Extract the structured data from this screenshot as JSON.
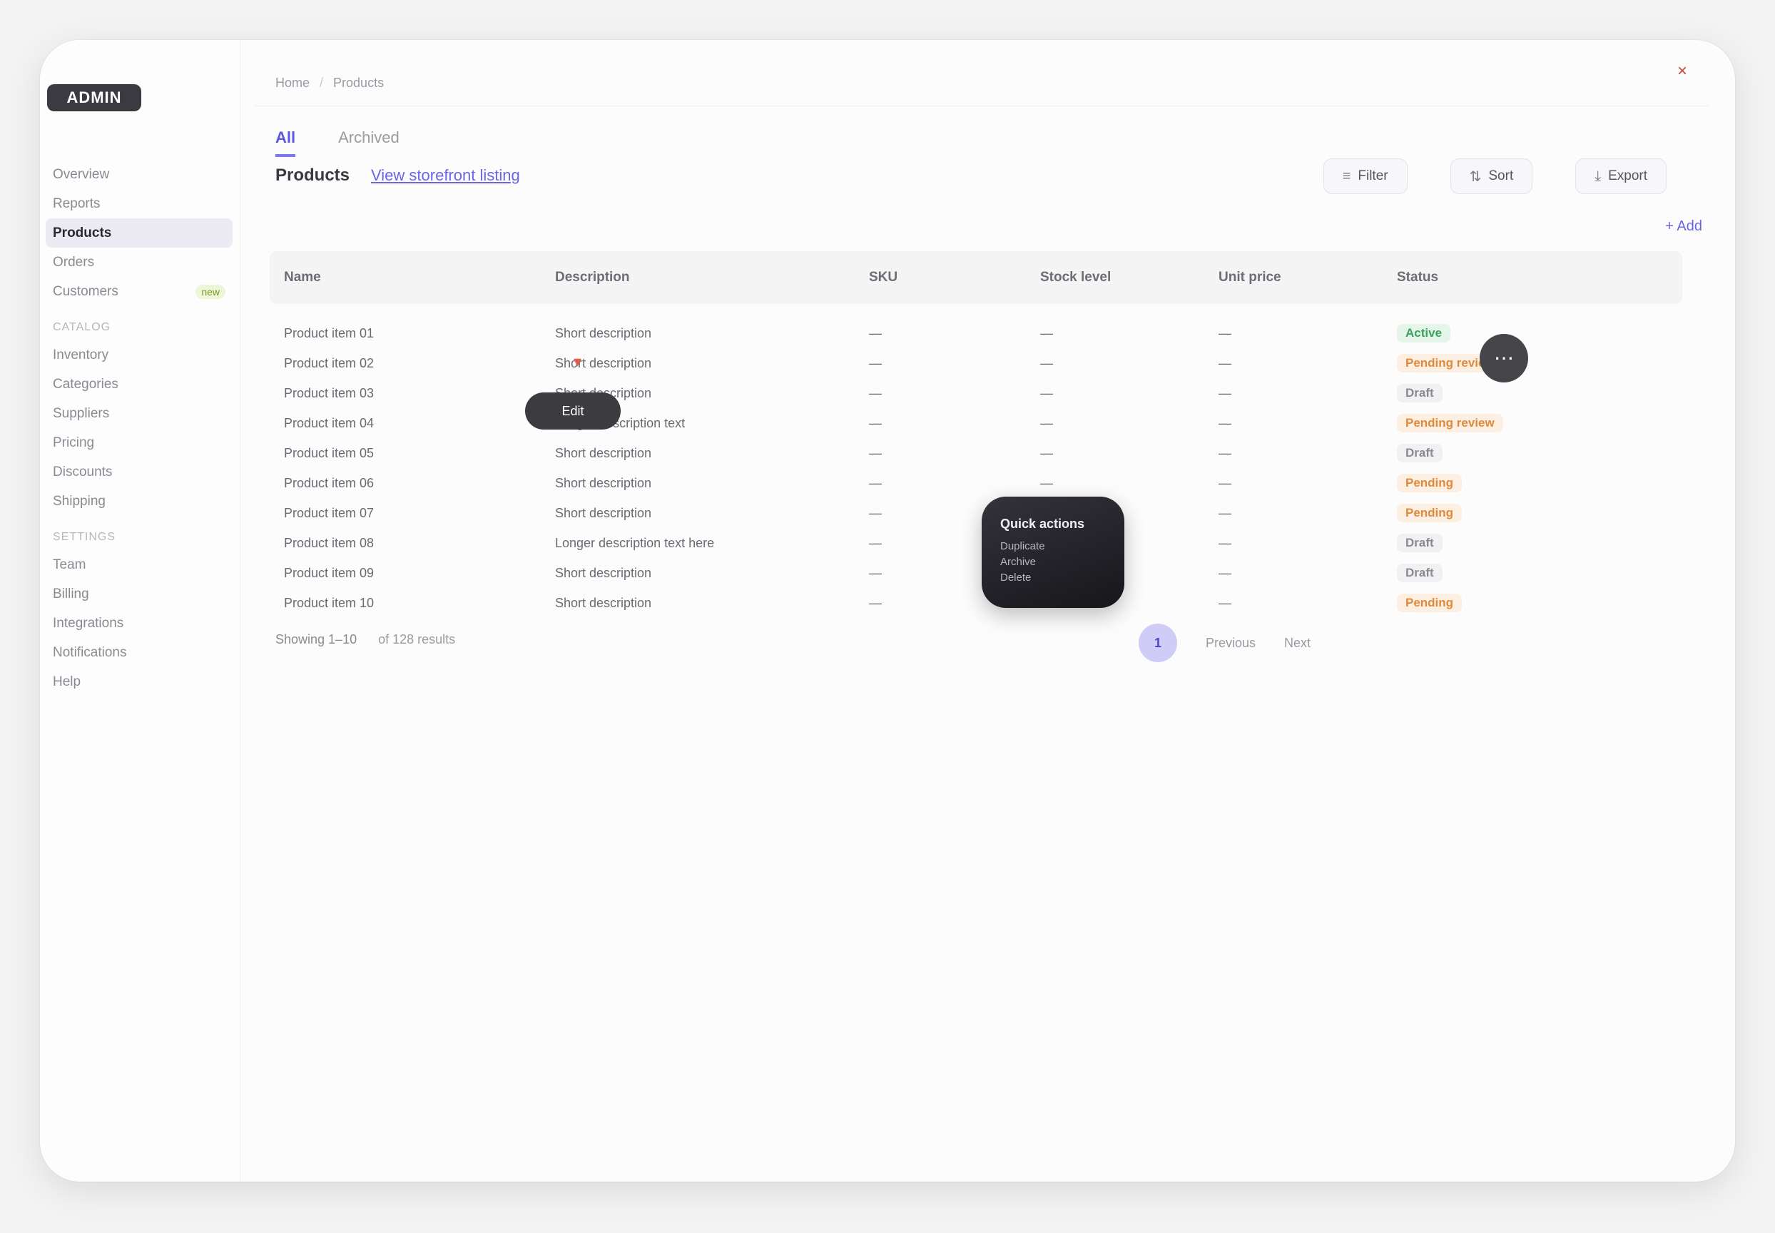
{
  "app": {
    "logo_text": "ADMIN"
  },
  "sidebar": {
    "items": [
      {
        "label": "Overview",
        "active": false
      },
      {
        "label": "Reports",
        "active": false
      },
      {
        "label": "Products",
        "active": true
      },
      {
        "label": "Orders",
        "active": false
      },
      {
        "label": "Customers",
        "active": false,
        "badge": "new"
      },
      {
        "label": "Catalog",
        "section": true
      },
      {
        "label": "Inventory",
        "active": false
      },
      {
        "label": "Categories",
        "active": false
      },
      {
        "label": "Suppliers",
        "active": false
      },
      {
        "label": "Pricing",
        "active": false
      },
      {
        "label": "Discounts",
        "active": false
      },
      {
        "label": "Shipping",
        "active": false
      },
      {
        "label": "Settings",
        "section": true
      },
      {
        "label": "Team",
        "active": false
      },
      {
        "label": "Billing",
        "active": false
      },
      {
        "label": "Integrations",
        "active": false
      },
      {
        "label": "Notifications",
        "active": false
      },
      {
        "label": "Help",
        "active": false
      }
    ]
  },
  "breadcrumb": [
    "Home",
    "Products"
  ],
  "tabs": [
    {
      "label": "All",
      "active": true
    },
    {
      "label": "Archived",
      "active": false
    }
  ],
  "header": {
    "title": "Products",
    "link": "View storefront listing",
    "actions": [
      {
        "label": "Filter",
        "icon": "filter-icon",
        "glyph": "≡"
      },
      {
        "label": "Sort",
        "icon": "sort-icon",
        "glyph": "⇅"
      },
      {
        "label": "Export",
        "icon": "download-icon",
        "glyph": "⤓"
      }
    ],
    "add_link": "+ Add"
  },
  "table": {
    "columns": [
      "Name",
      "Description",
      "SKU",
      "Stock level",
      "Unit price",
      "Status"
    ],
    "rows": [
      {
        "name": "Product item 01",
        "desc": "Short description",
        "sku": "—",
        "stock": "—",
        "price": "—",
        "status": "Active",
        "status_color": "#3aa35a",
        "status_bg": "#e6f5ea"
      },
      {
        "name": "Product item 02",
        "desc": "Short description",
        "sku": "—",
        "stock": "—",
        "price": "—",
        "status": "Pending review",
        "status_color": "#e08a3c",
        "status_bg": "#fdf0e3"
      },
      {
        "name": "Product item 03",
        "desc": "Short description",
        "sku": "—",
        "stock": "—",
        "price": "—",
        "status": "Draft",
        "status_color": "#8a8a92",
        "status_bg": "#f1f1f3"
      },
      {
        "name": "Product item 04",
        "desc": "Longer description text",
        "sku": "—",
        "stock": "—",
        "price": "—",
        "status": "Pending review",
        "status_color": "#e08a3c",
        "status_bg": "#fdf0e3"
      },
      {
        "name": "Product item 05",
        "desc": "Short description",
        "sku": "—",
        "stock": "—",
        "price": "—",
        "status": "Draft",
        "status_color": "#8a8a92",
        "status_bg": "#f1f1f3"
      },
      {
        "name": "Product item 06",
        "desc": "Short description",
        "sku": "—",
        "stock": "—",
        "price": "—",
        "status": "Pending",
        "status_color": "#e08a3c",
        "status_bg": "#fdf0e3"
      },
      {
        "name": "Product item 07",
        "desc": "Short description",
        "sku": "—",
        "stock": "—",
        "price": "—",
        "status": "Pending",
        "status_color": "#e08a3c",
        "status_bg": "#fdf0e3"
      },
      {
        "name": "Product item 08",
        "desc": "Longer description text here",
        "sku": "—",
        "stock": "—",
        "price": "—",
        "status": "Draft",
        "status_color": "#8a8a92",
        "status_bg": "#f1f1f3"
      },
      {
        "name": "Product item 09",
        "desc": "Short description",
        "sku": "—",
        "stock": "—",
        "price": "—",
        "status": "Draft",
        "status_color": "#8a8a92",
        "status_bg": "#f1f1f3"
      },
      {
        "name": "Product item 10",
        "desc": "Short description",
        "sku": "—",
        "stock": "—",
        "price": "—",
        "status": "Pending",
        "status_color": "#e08a3c",
        "status_bg": "#fdf0e3"
      }
    ]
  },
  "overlay": {
    "chip_label": "Edit",
    "fab_glyph": "⋯",
    "tooltip_title": "Quick actions",
    "tooltip_lines": [
      "Duplicate",
      "Archive",
      "Delete"
    ]
  },
  "pager": {
    "showing": "Showing 1–10",
    "of_total": "of 128 results",
    "current_page": "1",
    "prev": "Previous",
    "next": "Next"
  },
  "colors": {
    "accent": "#6b66e6"
  }
}
